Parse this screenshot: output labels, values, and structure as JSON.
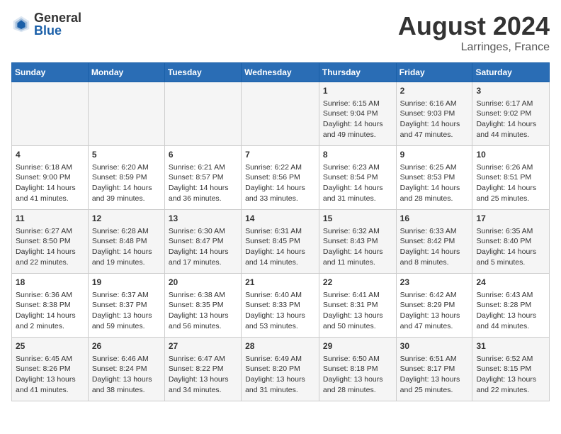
{
  "logo": {
    "general": "General",
    "blue": "Blue"
  },
  "title": "August 2024",
  "subtitle": "Larringes, France",
  "days_of_week": [
    "Sunday",
    "Monday",
    "Tuesday",
    "Wednesday",
    "Thursday",
    "Friday",
    "Saturday"
  ],
  "weeks": [
    [
      {
        "day": "",
        "info": ""
      },
      {
        "day": "",
        "info": ""
      },
      {
        "day": "",
        "info": ""
      },
      {
        "day": "",
        "info": ""
      },
      {
        "day": "1",
        "info": "Sunrise: 6:15 AM\nSunset: 9:04 PM\nDaylight: 14 hours\nand 49 minutes."
      },
      {
        "day": "2",
        "info": "Sunrise: 6:16 AM\nSunset: 9:03 PM\nDaylight: 14 hours\nand 47 minutes."
      },
      {
        "day": "3",
        "info": "Sunrise: 6:17 AM\nSunset: 9:02 PM\nDaylight: 14 hours\nand 44 minutes."
      }
    ],
    [
      {
        "day": "4",
        "info": "Sunrise: 6:18 AM\nSunset: 9:00 PM\nDaylight: 14 hours\nand 41 minutes."
      },
      {
        "day": "5",
        "info": "Sunrise: 6:20 AM\nSunset: 8:59 PM\nDaylight: 14 hours\nand 39 minutes."
      },
      {
        "day": "6",
        "info": "Sunrise: 6:21 AM\nSunset: 8:57 PM\nDaylight: 14 hours\nand 36 minutes."
      },
      {
        "day": "7",
        "info": "Sunrise: 6:22 AM\nSunset: 8:56 PM\nDaylight: 14 hours\nand 33 minutes."
      },
      {
        "day": "8",
        "info": "Sunrise: 6:23 AM\nSunset: 8:54 PM\nDaylight: 14 hours\nand 31 minutes."
      },
      {
        "day": "9",
        "info": "Sunrise: 6:25 AM\nSunset: 8:53 PM\nDaylight: 14 hours\nand 28 minutes."
      },
      {
        "day": "10",
        "info": "Sunrise: 6:26 AM\nSunset: 8:51 PM\nDaylight: 14 hours\nand 25 minutes."
      }
    ],
    [
      {
        "day": "11",
        "info": "Sunrise: 6:27 AM\nSunset: 8:50 PM\nDaylight: 14 hours\nand 22 minutes."
      },
      {
        "day": "12",
        "info": "Sunrise: 6:28 AM\nSunset: 8:48 PM\nDaylight: 14 hours\nand 19 minutes."
      },
      {
        "day": "13",
        "info": "Sunrise: 6:30 AM\nSunset: 8:47 PM\nDaylight: 14 hours\nand 17 minutes."
      },
      {
        "day": "14",
        "info": "Sunrise: 6:31 AM\nSunset: 8:45 PM\nDaylight: 14 hours\nand 14 minutes."
      },
      {
        "day": "15",
        "info": "Sunrise: 6:32 AM\nSunset: 8:43 PM\nDaylight: 14 hours\nand 11 minutes."
      },
      {
        "day": "16",
        "info": "Sunrise: 6:33 AM\nSunset: 8:42 PM\nDaylight: 14 hours\nand 8 minutes."
      },
      {
        "day": "17",
        "info": "Sunrise: 6:35 AM\nSunset: 8:40 PM\nDaylight: 14 hours\nand 5 minutes."
      }
    ],
    [
      {
        "day": "18",
        "info": "Sunrise: 6:36 AM\nSunset: 8:38 PM\nDaylight: 14 hours\nand 2 minutes."
      },
      {
        "day": "19",
        "info": "Sunrise: 6:37 AM\nSunset: 8:37 PM\nDaylight: 13 hours\nand 59 minutes."
      },
      {
        "day": "20",
        "info": "Sunrise: 6:38 AM\nSunset: 8:35 PM\nDaylight: 13 hours\nand 56 minutes."
      },
      {
        "day": "21",
        "info": "Sunrise: 6:40 AM\nSunset: 8:33 PM\nDaylight: 13 hours\nand 53 minutes."
      },
      {
        "day": "22",
        "info": "Sunrise: 6:41 AM\nSunset: 8:31 PM\nDaylight: 13 hours\nand 50 minutes."
      },
      {
        "day": "23",
        "info": "Sunrise: 6:42 AM\nSunset: 8:29 PM\nDaylight: 13 hours\nand 47 minutes."
      },
      {
        "day": "24",
        "info": "Sunrise: 6:43 AM\nSunset: 8:28 PM\nDaylight: 13 hours\nand 44 minutes."
      }
    ],
    [
      {
        "day": "25",
        "info": "Sunrise: 6:45 AM\nSunset: 8:26 PM\nDaylight: 13 hours\nand 41 minutes."
      },
      {
        "day": "26",
        "info": "Sunrise: 6:46 AM\nSunset: 8:24 PM\nDaylight: 13 hours\nand 38 minutes."
      },
      {
        "day": "27",
        "info": "Sunrise: 6:47 AM\nSunset: 8:22 PM\nDaylight: 13 hours\nand 34 minutes."
      },
      {
        "day": "28",
        "info": "Sunrise: 6:49 AM\nSunset: 8:20 PM\nDaylight: 13 hours\nand 31 minutes."
      },
      {
        "day": "29",
        "info": "Sunrise: 6:50 AM\nSunset: 8:18 PM\nDaylight: 13 hours\nand 28 minutes."
      },
      {
        "day": "30",
        "info": "Sunrise: 6:51 AM\nSunset: 8:17 PM\nDaylight: 13 hours\nand 25 minutes."
      },
      {
        "day": "31",
        "info": "Sunrise: 6:52 AM\nSunset: 8:15 PM\nDaylight: 13 hours\nand 22 minutes."
      }
    ]
  ]
}
